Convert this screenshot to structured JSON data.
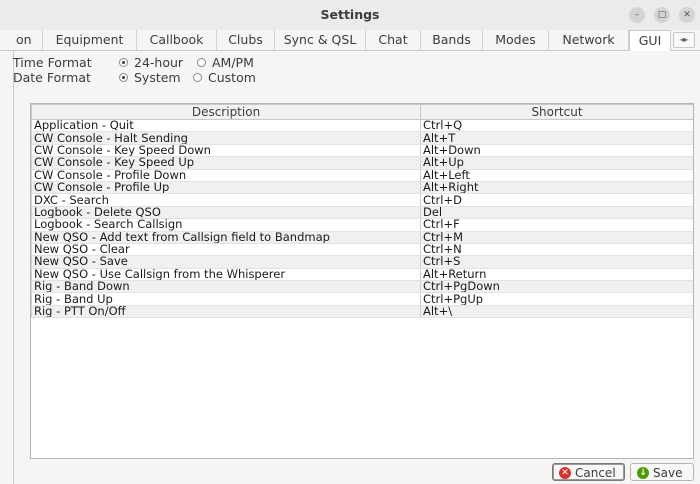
{
  "window": {
    "title": "Settings"
  },
  "tabs": [
    {
      "label": "on"
    },
    {
      "label": "Equipment"
    },
    {
      "label": "Callbook"
    },
    {
      "label": "Clubs"
    },
    {
      "label": "Sync & QSL"
    },
    {
      "label": "Chat"
    },
    {
      "label": "Bands"
    },
    {
      "label": "Modes"
    },
    {
      "label": "Network"
    },
    {
      "label": "GUI",
      "active": true
    }
  ],
  "tab_scroll": {
    "left": "◂",
    "right": "▸"
  },
  "time_format": {
    "label": "Time Format",
    "options": [
      {
        "label": "24-hour",
        "checked": true
      },
      {
        "label": "AM/PM",
        "checked": false
      }
    ]
  },
  "date_format": {
    "label": "Date Format",
    "options": [
      {
        "label": "System",
        "checked": true
      },
      {
        "label": "Custom",
        "checked": false
      }
    ]
  },
  "shortcuts_table": {
    "columns": [
      "Description",
      "Shortcut"
    ],
    "rows": [
      [
        "Application - Quit",
        "Ctrl+Q"
      ],
      [
        "CW Console - Halt Sending",
        "Alt+T"
      ],
      [
        "CW Console - Key Speed Down",
        "Alt+Down"
      ],
      [
        "CW Console - Key Speed Up",
        "Alt+Up"
      ],
      [
        "CW Console - Profile Down",
        "Alt+Left"
      ],
      [
        "CW Console - Profile Up",
        "Alt+Right"
      ],
      [
        "DXC - Search",
        "Ctrl+D"
      ],
      [
        "Logbook - Delete QSO",
        "Del"
      ],
      [
        "Logbook - Search Callsign",
        "Ctrl+F"
      ],
      [
        "New QSO - Add text from Callsign field to Bandmap",
        "Ctrl+M"
      ],
      [
        "New QSO - Clear",
        "Ctrl+N"
      ],
      [
        "New QSO - Save",
        "Ctrl+S"
      ],
      [
        "New QSO - Use Callsign from the Whisperer",
        "Alt+Return"
      ],
      [
        "Rig - Band Down",
        "Ctrl+PgDown"
      ],
      [
        "Rig - Band Up",
        "Ctrl+PgUp"
      ],
      [
        "Rig - PTT On/Off",
        "Alt+\\"
      ]
    ]
  },
  "footer": {
    "cancel_label": "Cancel",
    "save_label": "Save"
  },
  "colors": {
    "cancel_icon": "#d9332f",
    "save_icon": "#4e9a06"
  },
  "icons": [
    "minimize-icon",
    "maximize-icon",
    "close-icon",
    "cancel-icon",
    "save-icon"
  ]
}
